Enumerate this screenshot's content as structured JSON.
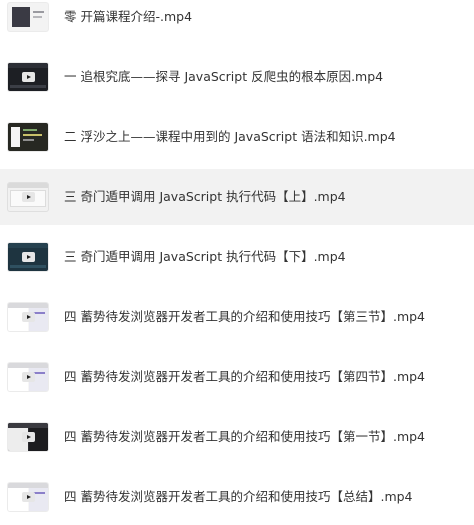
{
  "files": [
    {
      "name": "零 开篇课程介绍-.mp4",
      "thumbnail": "intro-slide",
      "selected": false
    },
    {
      "name": "一 追根究底——探寻 JavaScript 反爬虫的根本原因.mp4",
      "thumbnail": "dark-video",
      "selected": false
    },
    {
      "name": "二 浮沙之上——课程中用到的 JavaScript 语法和知识.mp4",
      "thumbnail": "code-editor",
      "selected": false
    },
    {
      "name": "三 奇门遁甲调用 JavaScript 执行代码【上】.mp4",
      "thumbnail": "light-video",
      "selected": true
    },
    {
      "name": "三 奇门遁甲调用 JavaScript 执行代码【下】.mp4",
      "thumbnail": "teal-video",
      "selected": false
    },
    {
      "name": "四 蓄势待发浏览器开发者工具的介绍和使用技巧【第三节】.mp4",
      "thumbnail": "devtools-light",
      "selected": false
    },
    {
      "name": "四 蓄势待发浏览器开发者工具的介绍和使用技巧【第四节】.mp4",
      "thumbnail": "devtools-light",
      "selected": false
    },
    {
      "name": "四 蓄势待发浏览器开发者工具的介绍和使用技巧【第一节】.mp4",
      "thumbnail": "devtools-dark",
      "selected": false
    },
    {
      "name": "四 蓄势待发浏览器开发者工具的介绍和使用技巧【总结】.mp4",
      "thumbnail": "devtools-light",
      "selected": false
    }
  ],
  "colors": {
    "text": "#333333",
    "selected_row_background": "#f2f2f2",
    "background": "#ffffff"
  }
}
